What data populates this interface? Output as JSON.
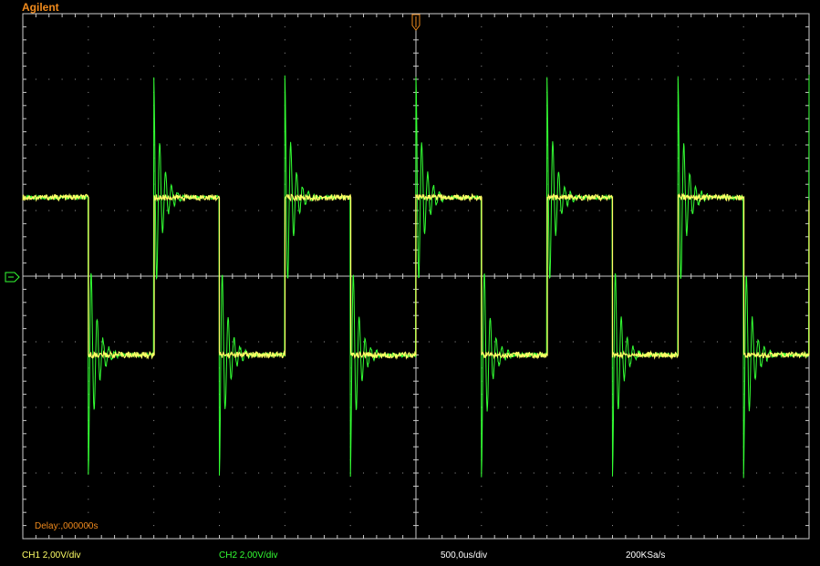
{
  "app": {
    "brand": "Agilent"
  },
  "display": {
    "delay_label": "Delay:,000000s",
    "grid": true,
    "divisions": {
      "x": 12,
      "y": 8
    },
    "colors": {
      "ch1": "#ffff66",
      "ch2": "#33ff33",
      "grid": "#ffffff",
      "label": "#f08a1c"
    },
    "trigger_marker_icon": "trigger-marker-icon",
    "ground_marker_icon": "ground-marker-icon"
  },
  "status_bar": {
    "ch1_scale": "CH1 2,00V/div",
    "ch2_scale": "CH2 2,00V/div",
    "timebase": "500,0us/div",
    "sample_rate": "200KSa/s"
  },
  "chart_data": {
    "type": "line",
    "xlabel": "",
    "ylabel": "",
    "x_unit": "ms",
    "y_unit": "V",
    "xlim": [
      -3.0,
      3.0
    ],
    "ylim": [
      -8.0,
      8.0
    ],
    "series": [
      {
        "channel": "CH1",
        "color": "#ffff66",
        "shape": "square",
        "period_ms": 1.0,
        "amplitude_v": 2.4,
        "edges_ms": [
          -2.5,
          -2.0,
          -1.5,
          -1.0,
          -0.5,
          0.0,
          0.5,
          1.0,
          1.5,
          2.0,
          2.5
        ],
        "starting_level": "high"
      },
      {
        "channel": "CH2",
        "color": "#33ff33",
        "shape": "square-with-ringing",
        "period_ms": 1.0,
        "amplitude_v": 2.4,
        "overshoot_peak_v": 6.1,
        "ringing_cycles": 5
      }
    ]
  }
}
